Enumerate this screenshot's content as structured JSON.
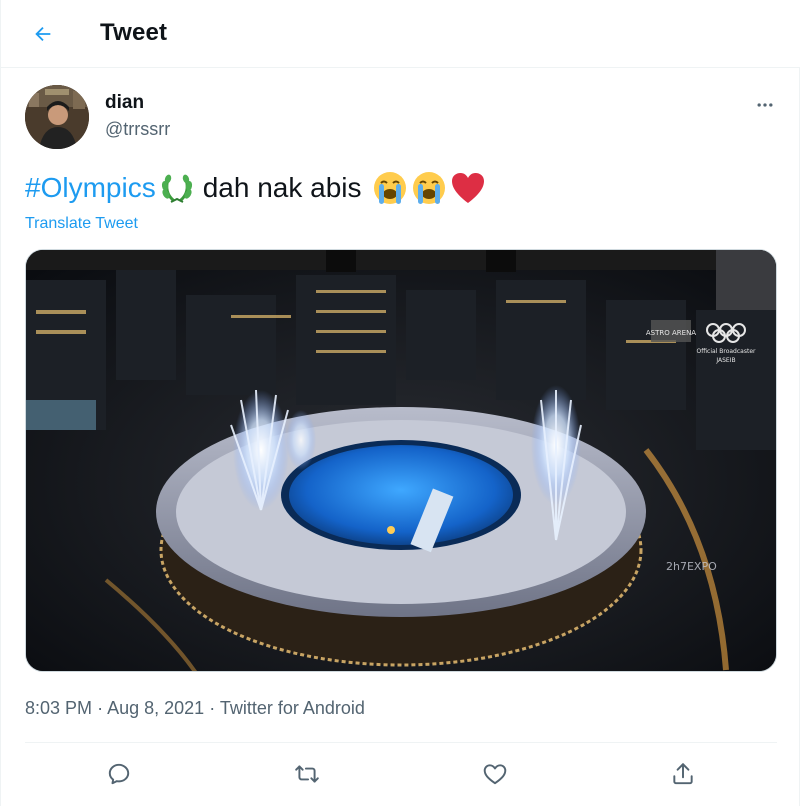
{
  "header": {
    "title": "Tweet",
    "back_icon": "arrow-left-icon"
  },
  "tweet": {
    "author": {
      "name": "dian",
      "handle": "@trrssrr"
    },
    "text": {
      "hashtag": "#Olympics",
      "body": "dah nak abis"
    },
    "emojis": [
      "laurel-wreath-icon",
      "loudly-crying-face-icon",
      "loudly-crying-face-icon",
      "red-heart-icon"
    ],
    "translate_label": "Translate Tweet",
    "media": {
      "overlay_watermark": "2h7EXPO",
      "broadcaster_text": "Official Broadcaster",
      "broadcaster_sub": "JASEIB",
      "logo_text": "ASTRO ARENA"
    },
    "time": "8:03 PM",
    "date": "Aug 8, 2021",
    "source": "Twitter for Android",
    "separator": "·"
  },
  "actions": [
    "reply-icon",
    "retweet-icon",
    "like-icon",
    "share-icon"
  ],
  "colors": {
    "accent": "#1d9bf0",
    "text": "#0f1419",
    "secondary": "#536471",
    "border": "#eff3f4"
  }
}
